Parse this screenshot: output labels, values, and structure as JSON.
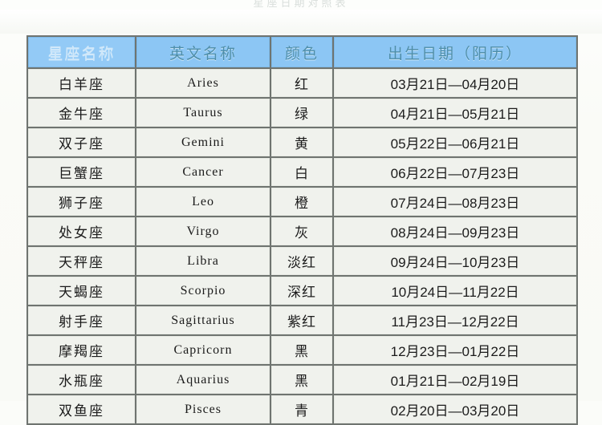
{
  "top_caption": "星座日期对照表",
  "table": {
    "headers": [
      {
        "key": "name",
        "label": "星座名称"
      },
      {
        "key": "en",
        "label": "英文名称"
      },
      {
        "key": "color",
        "label": "颜色"
      },
      {
        "key": "date",
        "label": "出生日期（阳历）"
      }
    ],
    "rows": [
      {
        "name": "白羊座",
        "en": "Aries",
        "color": "红",
        "date": "03月21日—04月20日"
      },
      {
        "name": "金牛座",
        "en": "Taurus",
        "color": "绿",
        "date": "04月21日—05月21日"
      },
      {
        "name": "双子座",
        "en": "Gemini",
        "color": "黄",
        "date": "05月22日—06月21日"
      },
      {
        "name": "巨蟹座",
        "en": "Cancer",
        "color": "白",
        "date": "06月22日—07月23日"
      },
      {
        "name": "狮子座",
        "en": "Leo",
        "color": "橙",
        "date": "07月24日—08月23日"
      },
      {
        "name": "处女座",
        "en": "Virgo",
        "color": "灰",
        "date": "08月24日—09月23日"
      },
      {
        "name": "天秤座",
        "en": "Libra",
        "color": "淡红",
        "date": "09月24日—10月23日"
      },
      {
        "name": "天蝎座",
        "en": "Scorpio",
        "color": "深红",
        "date": "10月24日—11月22日"
      },
      {
        "name": "射手座",
        "en": "Sagittarius",
        "color": "紫红",
        "date": "11月23日—12月22日"
      },
      {
        "name": "摩羯座",
        "en": "Capricorn",
        "color": "黑",
        "date": "12月23日—01月22日"
      },
      {
        "name": "水瓶座",
        "en": "Aquarius",
        "color": "黑",
        "date": "01月21日—02月19日"
      },
      {
        "name": "双鱼座",
        "en": "Pisces",
        "color": "青",
        "date": "02月20日—03月20日"
      }
    ]
  },
  "colors": {
    "header_bg": "#8cc5f2",
    "header_text": "#4f8ea8",
    "cell_bg": "#eef0eb",
    "grid": "#6f7470",
    "page_bg": "#fbfcf9"
  }
}
